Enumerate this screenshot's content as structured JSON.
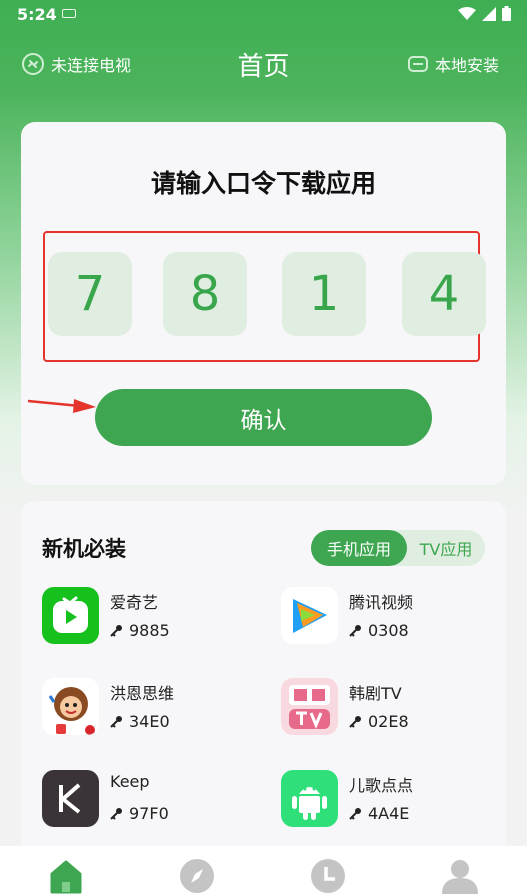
{
  "status_bar": {
    "time": "5:24"
  },
  "header": {
    "tv_status": "未连接电视",
    "title": "首页",
    "local_install": "本地安装"
  },
  "code_entry": {
    "title": "请输入口令下载应用",
    "digits": [
      "7",
      "8",
      "1",
      "4"
    ],
    "confirm_label": "确认"
  },
  "apps_section": {
    "title": "新机必装",
    "tabs": [
      {
        "label": "手机应用",
        "active": true
      },
      {
        "label": "TV应用",
        "active": false
      }
    ],
    "apps": [
      {
        "name": "爱奇艺",
        "code": "9885",
        "icon": "iqiyi-icon"
      },
      {
        "name": "腾讯视频",
        "code": "0308",
        "icon": "tencent-video-icon"
      },
      {
        "name": "洪恩思维",
        "code": "34E0",
        "icon": "hongen-icon"
      },
      {
        "name": "韩剧TV",
        "code": "02E8",
        "icon": "hanjutv-icon"
      },
      {
        "name": "Keep",
        "code": "97F0",
        "icon": "keep-icon"
      },
      {
        "name": "儿歌点点",
        "code": "4A4E",
        "icon": "android-icon"
      }
    ]
  },
  "bottom_nav": {
    "items": [
      {
        "icon": "home-icon",
        "active": true
      },
      {
        "icon": "compass-icon",
        "active": false
      },
      {
        "icon": "clock-icon",
        "active": false
      },
      {
        "icon": "profile-icon",
        "active": false
      }
    ]
  },
  "colors": {
    "accent": "#3ea650",
    "highlight_border": "#e5342c",
    "digit_bg": "#dfeee1"
  }
}
